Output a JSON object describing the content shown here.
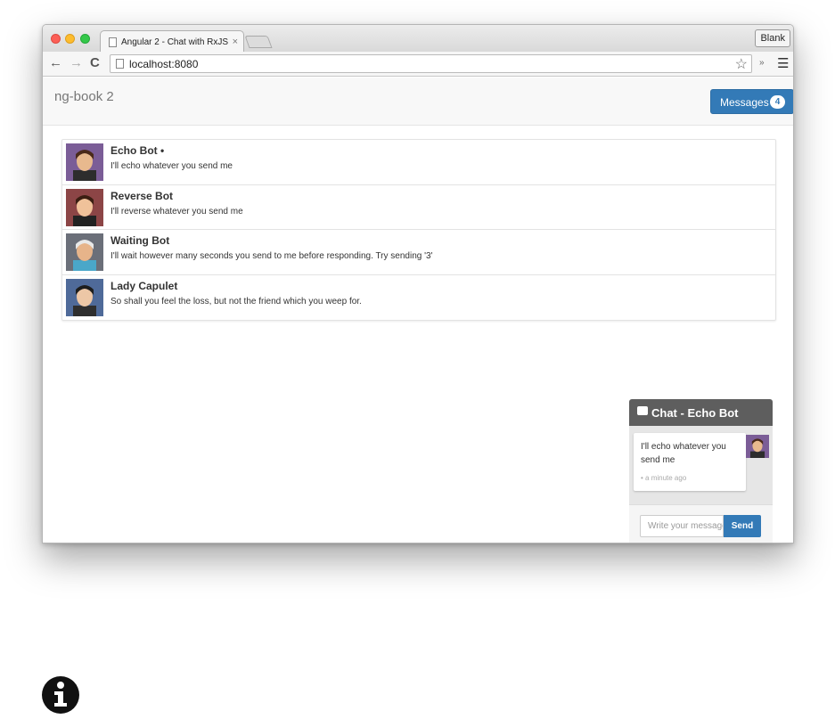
{
  "browser": {
    "tab_title": "Angular 2 - Chat with RxJS",
    "tab_close": "×",
    "blank_button": "Blank",
    "url": "localhost:8080",
    "back": "←",
    "forward": "→",
    "reload": "C",
    "star": "☆",
    "extensions": "»",
    "menu": "☰"
  },
  "app": {
    "brand": "ng-book 2",
    "messages_button": "Messages",
    "unread_count": "4"
  },
  "threads": [
    {
      "name": "Echo Bot •",
      "snippet": "I'll echo whatever you send me",
      "avatar_colors": {
        "bg": "#7b5d97",
        "hair": "#4a2a1a",
        "skin": "#e8b98e",
        "shirt": "#2d2d2d"
      }
    },
    {
      "name": "Reverse Bot",
      "snippet": "I'll reverse whatever you send me",
      "avatar_colors": {
        "bg": "#8c4546",
        "hair": "#3b1e12",
        "skin": "#f0c29a",
        "shirt": "#222"
      }
    },
    {
      "name": "Waiting Bot",
      "snippet": "I'll wait however many seconds you send to me before responding. Try sending '3'",
      "avatar_colors": {
        "bg": "#6b6f79",
        "hair": "#e8e8e8",
        "skin": "#e7b48a",
        "shirt": "#4aa7c9"
      }
    },
    {
      "name": "Lady Capulet",
      "snippet": "So shall you feel the loss, but not the friend which you weep for.",
      "avatar_colors": {
        "bg": "#4f6a99",
        "hair": "#1d1d1d",
        "skin": "#edc7a6",
        "shirt": "#2e2e2e"
      }
    }
  ],
  "chat": {
    "title": "Chat - Echo Bot",
    "message_text": "I'll echo whatever you send me",
    "message_time": "• a minute ago",
    "input_placeholder": "Write your message here",
    "send_label": "Send"
  },
  "colors": {
    "primary": "#337ab7",
    "chat_header": "#5e5e5e"
  }
}
